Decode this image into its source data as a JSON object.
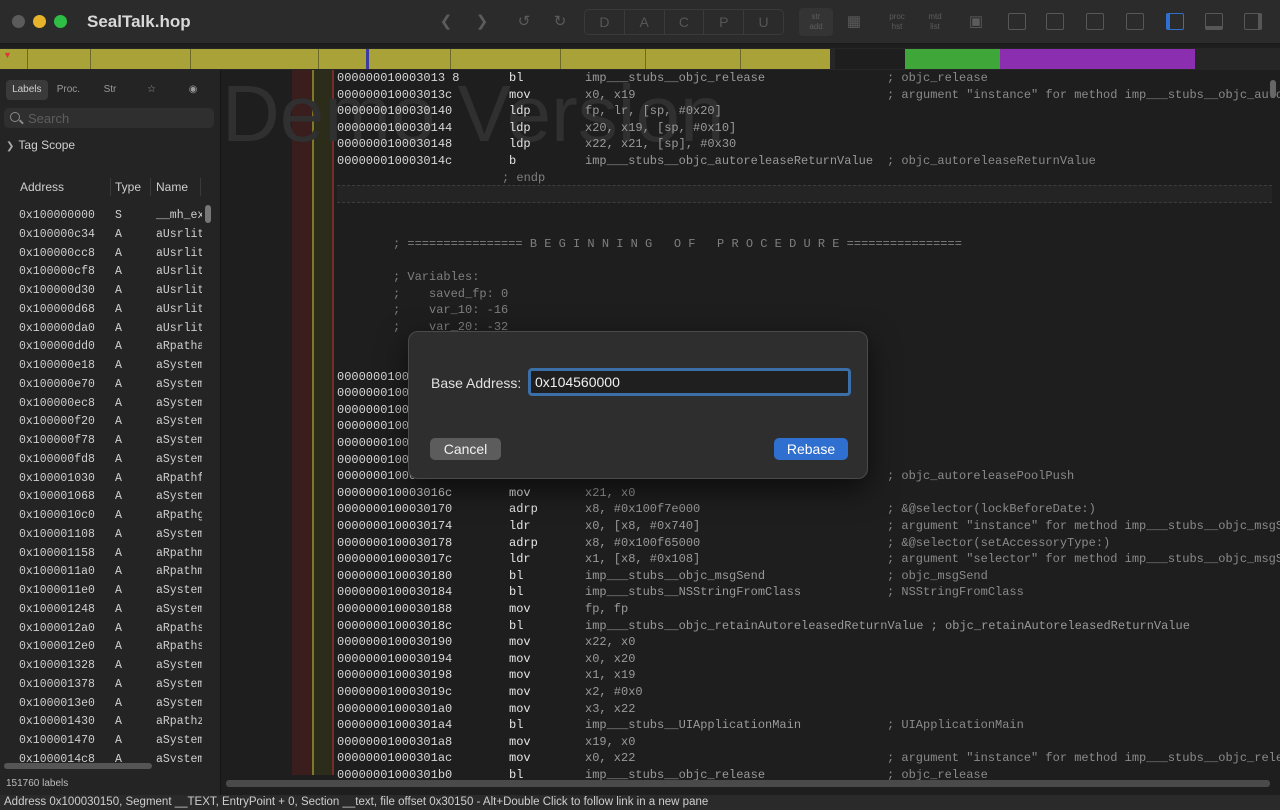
{
  "window": {
    "title": "SealTalk.hop"
  },
  "toolbar": {
    "letters": [
      "D",
      "A",
      "C",
      "P",
      "U"
    ],
    "small_buttons": [
      "str\nadd",
      "",
      "proc\nhst",
      "mtd\nlist"
    ]
  },
  "sidebar": {
    "tabs": [
      "Labels",
      "Proc.",
      "Str",
      "☆",
      "◉"
    ],
    "search_placeholder": "Search",
    "tag_scope": "Tag Scope",
    "columns": {
      "address": "Address",
      "type": "Type",
      "name": "Name"
    },
    "rows": [
      [
        "0x100000000",
        "S",
        "__mh_ex"
      ],
      [
        "0x100000c34",
        "A",
        "aUsrlit"
      ],
      [
        "0x100000cc8",
        "A",
        "aUsrlit"
      ],
      [
        "0x100000cf8",
        "A",
        "aUsrlit"
      ],
      [
        "0x100000d30",
        "A",
        "aUsrlit"
      ],
      [
        "0x100000d68",
        "A",
        "aUsrlit"
      ],
      [
        "0x100000da0",
        "A",
        "aUsrlit"
      ],
      [
        "0x100000dd0",
        "A",
        "aRpatha"
      ],
      [
        "0x100000e18",
        "A",
        "aSystem"
      ],
      [
        "0x100000e70",
        "A",
        "aSystem"
      ],
      [
        "0x100000ec8",
        "A",
        "aSystem"
      ],
      [
        "0x100000f20",
        "A",
        "aSystem"
      ],
      [
        "0x100000f78",
        "A",
        "aSystem"
      ],
      [
        "0x100000fd8",
        "A",
        "aSystem"
      ],
      [
        "0x100001030",
        "A",
        "aRpathf"
      ],
      [
        "0x100001068",
        "A",
        "aSystem"
      ],
      [
        "0x1000010c0",
        "A",
        "aRpathg"
      ],
      [
        "0x100001108",
        "A",
        "aSystem"
      ],
      [
        "0x100001158",
        "A",
        "aRpathm"
      ],
      [
        "0x1000011a0",
        "A",
        "aRpathm"
      ],
      [
        "0x1000011e0",
        "A",
        "aSystem"
      ],
      [
        "0x100001248",
        "A",
        "aSystem"
      ],
      [
        "0x1000012a0",
        "A",
        "aRpaths"
      ],
      [
        "0x1000012e0",
        "A",
        "aRpaths"
      ],
      [
        "0x100001328",
        "A",
        "aSystem"
      ],
      [
        "0x100001378",
        "A",
        "aSystem"
      ],
      [
        "0x1000013e0",
        "A",
        "aSystem"
      ],
      [
        "0x100001430",
        "A",
        "aRpathz"
      ],
      [
        "0x100001470",
        "A",
        "aSystem"
      ],
      [
        "0x1000014c8",
        "A",
        "aSystem"
      ]
    ],
    "count_label": "151760 labels"
  },
  "watermark": "Demo Version",
  "code_lines": [
    {
      "kind": "ins",
      "addr": "000000010003013 8",
      "mn": "bl",
      "op": "imp___stubs__objc_release",
      "cm": "; objc_release"
    },
    {
      "kind": "ins",
      "addr": "000000010003013c",
      "mn": "mov",
      "op": "x0, x19",
      "cm": "; argument \"instance\" for method imp___stubs__objc_auto"
    },
    {
      "kind": "ins",
      "addr": "0000000100030140",
      "mn": "ldp",
      "op": "fp, lr, [sp, #0x20]",
      "cm": ""
    },
    {
      "kind": "ins",
      "addr": "0000000100030144",
      "mn": "ldp",
      "op": "x20, x19, [sp, #0x10]",
      "cm": ""
    },
    {
      "kind": "ins",
      "addr": "0000000100030148",
      "mn": "ldp",
      "op": "x22, x21, [sp], #0x30",
      "cm": ""
    },
    {
      "kind": "ins",
      "addr": "000000010003014c",
      "mn": "b",
      "op": "imp___stubs__objc_autoreleaseReturnValue",
      "cm": "; objc_autoreleaseReturnValue"
    },
    {
      "kind": "endp",
      "text": "; endp"
    },
    {
      "kind": "blank"
    },
    {
      "kind": "blank"
    },
    {
      "kind": "blank"
    },
    {
      "kind": "text",
      "text": "; ================ B E G I N N I N G   O F   P R O C E D U R E ================"
    },
    {
      "kind": "blank"
    },
    {
      "kind": "text",
      "text": "; Variables:"
    },
    {
      "kind": "text",
      "text": ";    saved_fp: 0"
    },
    {
      "kind": "text",
      "text": ";    var_10: -16"
    },
    {
      "kind": "text",
      "text": ";    var_20: -32"
    },
    {
      "kind": "blank"
    },
    {
      "kind": "blank"
    },
    {
      "kind": "ins",
      "addr": "0000000100030150",
      "mn": "",
      "op": "",
      "cm": ""
    },
    {
      "kind": "ins",
      "addr": "0000000100030154",
      "mn": "",
      "op": "",
      "cm": ""
    },
    {
      "kind": "ins",
      "addr": "0000000100030158",
      "mn": "",
      "op": "",
      "cm": ""
    },
    {
      "kind": "ins",
      "addr": "000000010003015c",
      "mn": "",
      "op": "",
      "cm": ""
    },
    {
      "kind": "ins",
      "addr": "0000000100030160",
      "mn": "",
      "op": "",
      "cm": ""
    },
    {
      "kind": "ins",
      "addr": "0000000100030164",
      "mn": "",
      "op": "",
      "cm": ""
    },
    {
      "kind": "ins",
      "addr": "0000000100030168",
      "mn": "",
      "op": "",
      "cm": "; objc_autoreleasePoolPush"
    },
    {
      "kind": "ins",
      "addr": "000000010003016c",
      "mn": "mov",
      "op": "x21, x0",
      "cm": ""
    },
    {
      "kind": "ins",
      "addr": "0000000100030170",
      "mn": "adrp",
      "op": "x8, #0x100f7e000",
      "cm": "; &@selector(lockBeforeDate:)"
    },
    {
      "kind": "ins",
      "addr": "0000000100030174",
      "mn": "ldr",
      "op": "x0, [x8, #0x740]",
      "cm": "; argument \"instance\" for method imp___stubs__objc_msgS"
    },
    {
      "kind": "ins",
      "addr": "0000000100030178",
      "mn": "adrp",
      "op": "x8, #0x100f65000",
      "cm": "; &@selector(setAccessoryType:)"
    },
    {
      "kind": "ins",
      "addr": "000000010003017c",
      "mn": "ldr",
      "op": "x1, [x8, #0x108]",
      "cm": "; argument \"selector\" for method imp___stubs__objc_msgS"
    },
    {
      "kind": "ins",
      "addr": "0000000100030180",
      "mn": "bl",
      "op": "imp___stubs__objc_msgSend",
      "cm": "; objc_msgSend"
    },
    {
      "kind": "ins",
      "addr": "0000000100030184",
      "mn": "bl",
      "op": "imp___stubs__NSStringFromClass",
      "cm": "; NSStringFromClass"
    },
    {
      "kind": "ins",
      "addr": "0000000100030188",
      "mn": "mov",
      "op": "fp, fp",
      "cm": ""
    },
    {
      "kind": "ins",
      "addr": "000000010003018c",
      "mn": "bl",
      "op": "imp___stubs__objc_retainAutoreleasedReturnValue ; objc_retainAutoreleasedReturnValue",
      "cm": ""
    },
    {
      "kind": "ins",
      "addr": "0000000100030190",
      "mn": "mov",
      "op": "x22, x0",
      "cm": ""
    },
    {
      "kind": "ins",
      "addr": "0000000100030194",
      "mn": "mov",
      "op": "x0, x20",
      "cm": ""
    },
    {
      "kind": "ins",
      "addr": "0000000100030198",
      "mn": "mov",
      "op": "x1, x19",
      "cm": ""
    },
    {
      "kind": "ins",
      "addr": "000000010003019c",
      "mn": "mov",
      "op": "x2, #0x0",
      "cm": ""
    },
    {
      "kind": "ins",
      "addr": "00000001000301a0",
      "mn": "mov",
      "op": "x3, x22",
      "cm": ""
    },
    {
      "kind": "ins",
      "addr": "00000001000301a4",
      "mn": "bl",
      "op": "imp___stubs__UIApplicationMain",
      "cm": "; UIApplicationMain"
    },
    {
      "kind": "ins",
      "addr": "00000001000301a8",
      "mn": "mov",
      "op": "x19, x0",
      "cm": ""
    },
    {
      "kind": "ins",
      "addr": "00000001000301ac",
      "mn": "mov",
      "op": "x0, x22",
      "cm": "; argument \"instance\" for method imp___stubs__objc_rele"
    },
    {
      "kind": "ins",
      "addr": "00000001000301b0",
      "mn": "bl",
      "op": "imp___stubs__objc_release",
      "cm": "; objc_release"
    }
  ],
  "dialog": {
    "label": "Base Address:",
    "value": "0x104560000",
    "cancel": "Cancel",
    "confirm": "Rebase"
  },
  "status": "Address 0x100030150, Segment __TEXT, EntryPoint + 0, Section __text, file offset 0x30150 - Alt+Double Click to follow link in a new pane"
}
